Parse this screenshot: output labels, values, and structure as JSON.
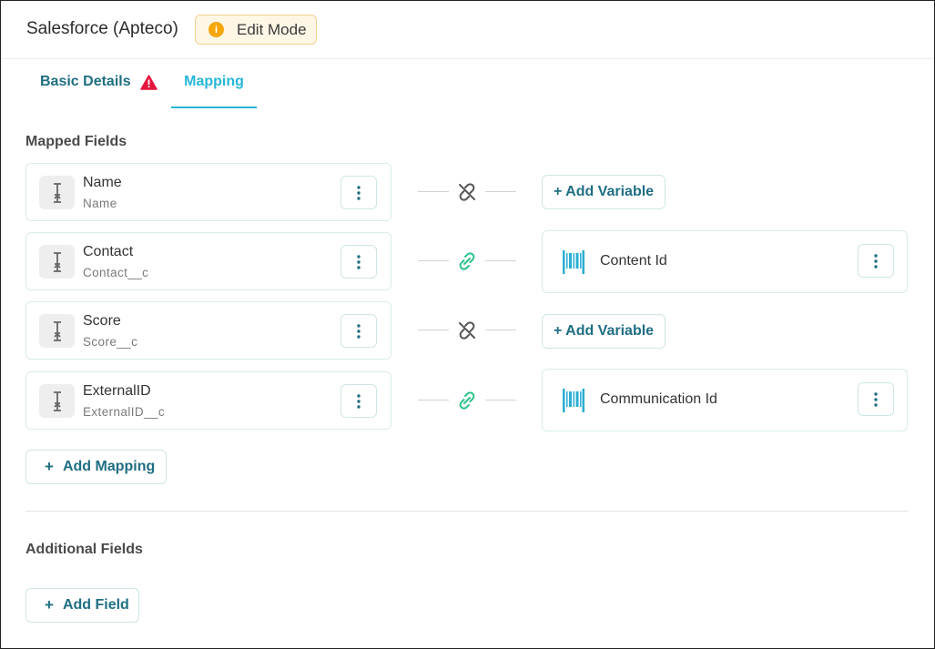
{
  "header": {
    "title": "Salesforce (Apteco)",
    "mode_badge": "Edit Mode",
    "mode_badge_icon": "info-icon"
  },
  "tabs": [
    {
      "label": "Basic Details",
      "has_warning": true,
      "active": false
    },
    {
      "label": "Mapping",
      "active": true
    }
  ],
  "mapped_fields": {
    "title": "Mapped Fields",
    "rows": [
      {
        "field_name": "Name",
        "field_api": "Name",
        "linked": false,
        "variable": null,
        "add_variable_label": "+ Add Variable"
      },
      {
        "field_name": "Contact",
        "field_api": "Contact__c",
        "linked": true,
        "variable": "Content Id"
      },
      {
        "field_name": "Score",
        "field_api": "Score__c",
        "linked": false,
        "variable": null,
        "add_variable_label": "+ Add Variable"
      },
      {
        "field_name": "ExternalID",
        "field_api": "ExternalID__c",
        "linked": true,
        "variable": "Communication Id"
      }
    ],
    "add_mapping_label": "Add Mapping"
  },
  "additional_fields": {
    "title": "Additional Fields",
    "add_field_label": "Add Field"
  },
  "colors": {
    "accent": "#27b6d8",
    "primary_text": "#1f6e83",
    "warning": "#e5173f",
    "badge": "#f6a609",
    "linked": "#2cc28a",
    "unlinked": "#555555"
  }
}
